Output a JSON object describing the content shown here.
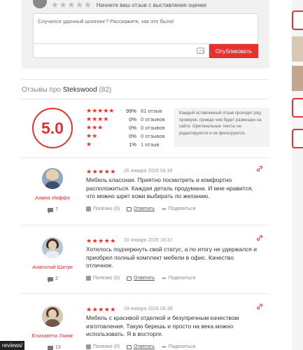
{
  "review_form": {
    "stars": "★★★★★",
    "hint": "Начните ваш отзыв с выставления оценки",
    "textarea_placeholder": "Случился удачный шоппинг? Расскажите, как это было!",
    "publish_label": "Опубликовать"
  },
  "reviews_header": {
    "prefix": "Отзывы про ",
    "brand": "Stekswood",
    "count": "(82)"
  },
  "summary": {
    "score": "5.0",
    "distribution": [
      {
        "stars": "★★★★★",
        "percent": "99%",
        "count": "81 отзыв"
      },
      {
        "stars": "★★★★",
        "percent": "0%",
        "count": "0 отзывов"
      },
      {
        "stars": "★★★",
        "percent": "0%",
        "count": "0 отзывов"
      },
      {
        "stars": "★★",
        "percent": "0%",
        "count": "0 отзывов"
      },
      {
        "stars": "★",
        "percent": "1%",
        "count": "1 отзыв"
      }
    ],
    "note": "Каждый оставленный отзыв проходит ряд проверок, прежде чем будет размещен на сайте. Оригинальные тексты не редактируются и не фильтруются."
  },
  "reviews": [
    {
      "name": "Алина Иоффэ",
      "stars": "★★★★★",
      "date": "26 января 2026 04:39",
      "text": "Мебель классная. Приятно посмотреть и комфортно расположиться. Каждая деталь продумана. И мне нравится, что можно шрет кожи выбирать по желанию.",
      "comments": "7",
      "helpful": "Полезно (0)",
      "reply": "Ответить",
      "share": "Поделиться"
    },
    {
      "name": "Анатолий Шатун",
      "stars": "★★★★★",
      "date": "20 января 2026 16:37",
      "text": "Хотелось подчеркнуть свой статус, а по итогу не удержался и приобрел полный комплект мебели в офис. Качество отличное.",
      "comments": "2",
      "helpful": "Полезно (0)",
      "reply": "Ответить",
      "share": "Поделиться"
    },
    {
      "name": "Елизавета Лалаг",
      "stars": "★★★★★",
      "date": "19 января 2026 06:38",
      "text": "Мебель с красивой отделкой и безупречным качеством изготовления. Такую берешь и просто на века можно использовать. Я в восторге.",
      "comments": "13",
      "helpful": "Полезно (0)",
      "reply": "Ответить",
      "share": "Поделиться"
    }
  ],
  "bottom_tag": "reviews/",
  "colors": {
    "accent": "#e8312f",
    "panel": "#f1f1f1"
  }
}
